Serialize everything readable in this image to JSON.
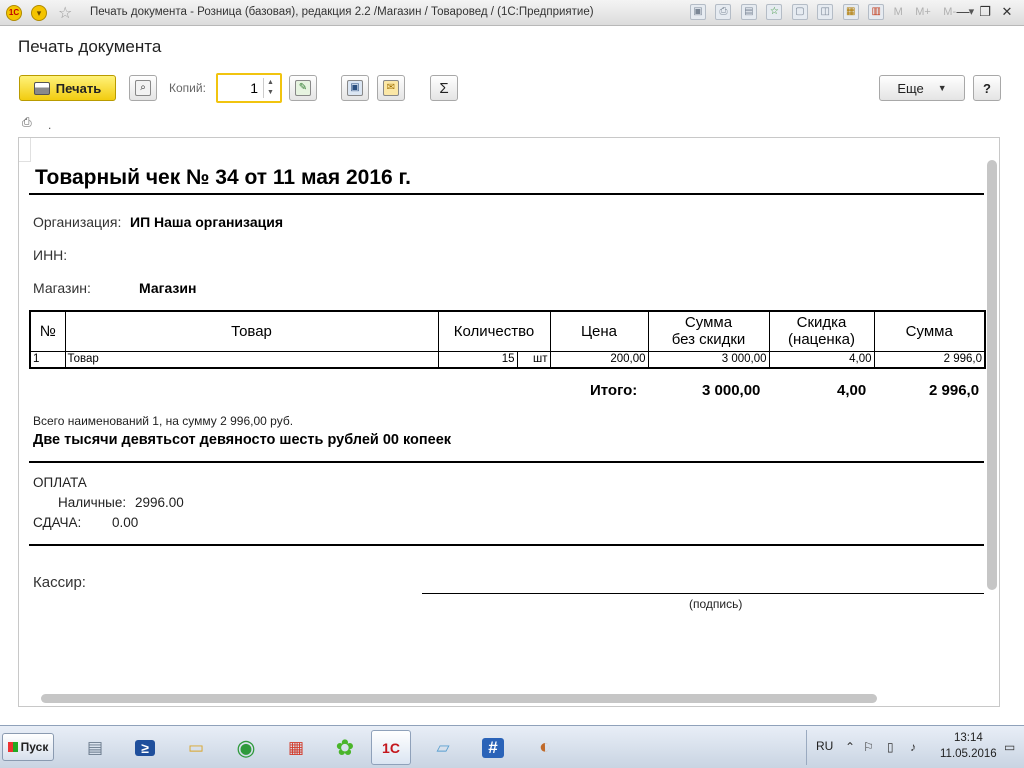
{
  "window": {
    "title": "Печать документа - Розница (базовая), редакция 2.2 /Магазин / Товаровед /  (1С:Предприятие)",
    "logo_text": "1С",
    "menu_letters": [
      "M",
      "M+",
      "M-"
    ],
    "minimize_symbol": "—",
    "restore_symbol": "❐",
    "close_symbol": "✕"
  },
  "header": {
    "title": "Печать документа"
  },
  "toolbar": {
    "print_label": "Печать",
    "copies_label": "Копий:",
    "copies_value": "1",
    "more_label": "Еще",
    "help_label": "?",
    "sum_symbol": "Σ",
    "small_dot": "."
  },
  "document": {
    "title": "Товарный чек № 34 от 11 мая 2016 г.",
    "org_label": "Организация:",
    "org_value": "ИП Наша организация",
    "inn_label": "ИНН:",
    "shop_label": "Магазин:",
    "shop_value": "Магазин",
    "table": {
      "headers": [
        "№",
        "Товар",
        "Количество",
        "Цена",
        "Сумма без скидки",
        "Скидка (наценка)",
        "Сумма"
      ],
      "header_lines": {
        "sum_nodisc_1": "Сумма",
        "sum_nodisc_2": "без скидки",
        "discount_1": "Скидка",
        "discount_2": "(наценка)"
      },
      "rows": [
        {
          "num": "1",
          "item": "Товар",
          "qty": "15",
          "unit": "шт",
          "price": "200,00",
          "sum_no_discount": "3 000,00",
          "discount": "4,00",
          "sum": "2 996,0"
        }
      ]
    },
    "totals": {
      "label": "Итого:",
      "sum_no_discount": "3 000,00",
      "discount": "4,00",
      "sum": "2 996,0"
    },
    "summary_small": "Всего наименований 1, на сумму 2 996,00 руб.",
    "summary_words": "Две тысячи девятьсот девяносто шесть рублей 00 копеек",
    "payment": {
      "header": "ОПЛАТА",
      "cash_label": "Наличные:",
      "cash_value": "2996.00",
      "change_label": "СДАЧА:",
      "change_value": "0.00"
    },
    "cashier_label": "Кассир:",
    "signature_caption": "(подпись)"
  },
  "taskbar": {
    "start_label": "Пуск",
    "lang": "RU",
    "time": "13:14",
    "date": "11.05.2016",
    "apps": [
      {
        "name": "server-manager",
        "glyph": "▤",
        "color": "#6a7a8c"
      },
      {
        "name": "powershell",
        "glyph": "≥",
        "color": "#1f4f9c"
      },
      {
        "name": "explorer",
        "glyph": "▭",
        "color": "#d9a52b"
      },
      {
        "name": "chrome",
        "glyph": "◉",
        "color": "#2f9a3c"
      },
      {
        "name": "app-grid",
        "glyph": "▦",
        "color": "#d23a2a"
      },
      {
        "name": "icq",
        "glyph": "✿",
        "color": "#4ab52a"
      },
      {
        "name": "1c",
        "glyph": "1С",
        "color": "#c4161c"
      },
      {
        "name": "notepad",
        "glyph": "▱",
        "color": "#5aa0d0"
      },
      {
        "name": "hashtag",
        "glyph": "#",
        "color": "#2a63b8"
      },
      {
        "name": "paint",
        "glyph": "◐",
        "color": "#c06a2a"
      }
    ]
  }
}
